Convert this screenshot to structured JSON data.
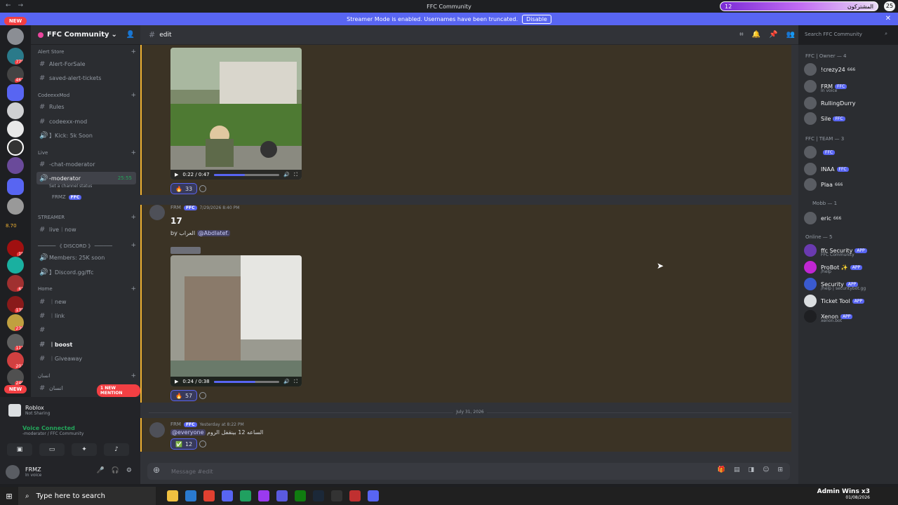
{
  "app": {
    "title": "FFC Community",
    "top_right_banner_text": "المشتركون",
    "top_right_banner_number": "12",
    "top_right_count": "25"
  },
  "streamer_bar": {
    "text": "Streamer Mode is enabled. Usernames have been truncated.",
    "button": "Disable"
  },
  "guilds": {
    "new_label": "NEW",
    "badges": [
      "778",
      "467",
      "8.70",
      "15",
      "63",
      "135",
      "236",
      "111",
      "201",
      "246"
    ]
  },
  "server": {
    "name": "FFC Community",
    "categories": {
      "alert_store": "Alert Store",
      "codeexx": "CodeexxMod",
      "live": "Live",
      "streamer": "STREAMER",
      "discord": "────── 《 DISCORD 》 ──────",
      "home": "Home",
      "insan": "انسان"
    },
    "channels": {
      "alert_forsale": "Alert-ForSale",
      "saved_alert": "saved-alert-tickets",
      "rules": "Rules",
      "codeexx_mod": "codeexx-mod",
      "kick": "】Kick: 5k Soon",
      "chat_moderator": "-chat-moderator",
      "moderator": "-moderator",
      "moderator_time": "25:55",
      "moderator_status": "Set a channel status",
      "moderator_user": "FRMZ",
      "moderator_user_tag": "FFC",
      "live_now": "live︱now",
      "members": "Members: 25K soon",
      "discord_link": "】Discord.gg/ffc",
      "new": "︱new",
      "link": "︱link",
      "blank": "",
      "boost": "︱boost",
      "giveaway": "︱Giveaway",
      "insan": "انسان"
    },
    "new_mention": "1 NEW MENTION"
  },
  "activity": {
    "title": "Roblox",
    "sub": "Not Sharing"
  },
  "voice": {
    "title": "Voice Connected",
    "sub": "-moderator / FFC Community"
  },
  "me": {
    "name": "FRMZ",
    "status": "In voice"
  },
  "chat": {
    "channel": "edit",
    "search_placeholder": "Search FFC Community",
    "video1_time": "0:22 / 0:47",
    "video1_progress": 0.47,
    "react1_count": "33",
    "msg2_user": "FRM",
    "msg2_tag": "FFC",
    "msg2_time": "7/29/2026 8:40 PM",
    "msg2_big": "17",
    "msg2_by": "by العراب",
    "msg2_mention": "@Abdlatef.",
    "video2_time": "0:24 / 0:38",
    "video2_progress": 0.63,
    "react2_count": "57",
    "divider": "July 31, 2026",
    "msg3_user": "FRM",
    "msg3_tag": "FFC",
    "msg3_time": "Yesterday at 8:22 PM",
    "msg3_mention": "@everyone",
    "msg3_text": "الساعه 12 بينقفل الروم",
    "react3_count": "12",
    "composer_placeholder": "Message #edit"
  },
  "members": {
    "owner_cat": "FFC | Owner — 4",
    "team_cat": "FFC | TEAM — 3",
    "mobb_cat": "Mobb — 1",
    "online_cat": "Online — 5",
    "list": [
      {
        "name": "!crezy24",
        "tag": "666",
        "sub": ""
      },
      {
        "name": "FRM",
        "tag": "FFC",
        "sub": "In voice"
      },
      {
        "name": "RullingDurry",
        "tag": "",
        "sub": ""
      },
      {
        "name": "Sile",
        "tag": "FFC",
        "sub": ""
      },
      {
        "name": "",
        "tag": "FFC",
        "sub": ""
      },
      {
        "name": "INAA",
        "tag": "FFC",
        "sub": ""
      },
      {
        "name": "Plaa",
        "tag": "666",
        "sub": ""
      },
      {
        "name": "eric",
        "tag": "666",
        "sub": ""
      },
      {
        "name": "ffc Security",
        "tag": "APP",
        "sub": "FFC Community"
      },
      {
        "name": "ProBot ✨",
        "tag": "APP",
        "sub": "/help"
      },
      {
        "name": "Security",
        "tag": "APP",
        "sub": "/help | securitybot.gg"
      },
      {
        "name": "Ticket Tool",
        "tag": "APP",
        "sub": ""
      },
      {
        "name": "Xenon",
        "tag": "APP",
        "sub": "xenon.bot"
      }
    ]
  },
  "taskbar": {
    "search": "Type here to search",
    "tray_text": "Admin Wins x3",
    "tray_date": "01/08/2026"
  }
}
